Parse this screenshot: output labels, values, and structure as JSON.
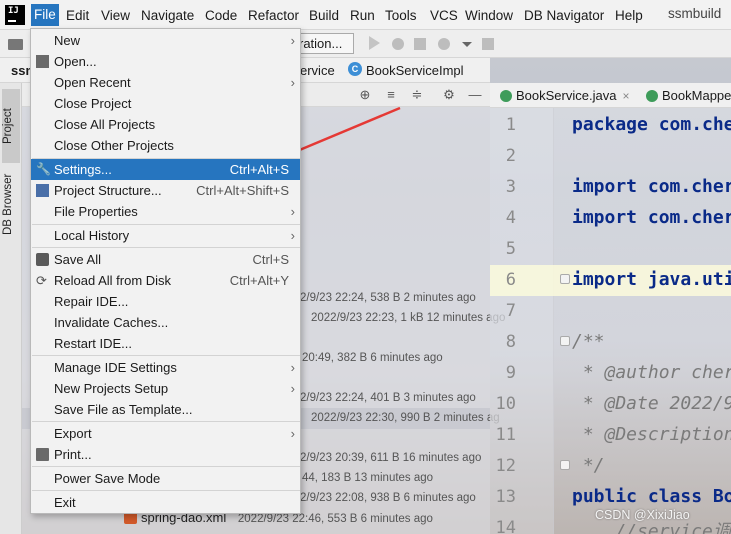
{
  "menubar": {
    "items": [
      "File",
      "Edit",
      "View",
      "Navigate",
      "Code",
      "Refactor",
      "Build",
      "Run",
      "Tools",
      "VCS",
      "Window",
      "DB Navigator",
      "Help"
    ],
    "active": "File",
    "project_name": "ssmbuild"
  },
  "toolbar": {
    "run_config": "ration..."
  },
  "breadcrumb": {
    "project": "ssm",
    "package": "ervice",
    "class": "BookServiceImpl"
  },
  "side_tabs": {
    "project": "Project",
    "db_browser": "DB Browser"
  },
  "project_panel": {
    "file_meta": [
      "2/9/23 22:24, 538 B 2 minutes ago",
      "2022/9/23 22:23, 1 kB 12 minutes ago",
      "20:49, 382 B 6 minutes ago",
      "2/9/23 22:24, 401 B 3 minutes ago",
      "2022/9/23 22:30, 990 B 2 minutes ag",
      "2/9/23 20:39, 611 B 16 minutes ago",
      "44, 183 B 13 minutes ago",
      "2/9/23 22:08, 938 B 6 minutes ago"
    ],
    "last_file": {
      "name": "spring-dao.xml",
      "meta": "2022/9/23 22:46, 553 B 6 minutes ago"
    }
  },
  "editor": {
    "tabs": [
      "BookService.java",
      "BookMappe"
    ],
    "lines": [
      {
        "n": "1",
        "t": "package com.che"
      },
      {
        "n": "2",
        "t": ""
      },
      {
        "n": "3",
        "t": "import com.cher"
      },
      {
        "n": "4",
        "t": "import com.cher"
      },
      {
        "n": "5",
        "t": ""
      },
      {
        "n": "6",
        "t": "import java.uti"
      },
      {
        "n": "7",
        "t": ""
      },
      {
        "n": "8",
        "t": "/**"
      },
      {
        "n": "9",
        "t": " * @author cher"
      },
      {
        "n": "10",
        "t": " * @Date 2022/9"
      },
      {
        "n": "11",
        "t": " * @Description"
      },
      {
        "n": "12",
        "t": " */"
      },
      {
        "n": "13",
        "t": "public class Bo"
      },
      {
        "n": "14",
        "t": "    //service调"
      }
    ]
  },
  "watermark": "CSDN @XixiJiao",
  "file_menu": {
    "items": [
      {
        "label": "New",
        "shortcut": "",
        "submenu": true
      },
      {
        "label": "Open...",
        "shortcut": "",
        "submenu": false
      },
      {
        "label": "Open Recent",
        "shortcut": "",
        "submenu": true
      },
      {
        "label": "Close Project",
        "shortcut": "",
        "submenu": false
      },
      {
        "label": "Close All Projects",
        "shortcut": "",
        "submenu": false
      },
      {
        "label": "Close Other Projects",
        "shortcut": "",
        "submenu": false
      },
      {
        "label": "Settings...",
        "shortcut": "Ctrl+Alt+S",
        "submenu": false
      },
      {
        "label": "Project Structure...",
        "shortcut": "Ctrl+Alt+Shift+S",
        "submenu": false
      },
      {
        "label": "File Properties",
        "shortcut": "",
        "submenu": true
      },
      {
        "label": "Local History",
        "shortcut": "",
        "submenu": true
      },
      {
        "label": "Save All",
        "shortcut": "Ctrl+S",
        "submenu": false
      },
      {
        "label": "Reload All from Disk",
        "shortcut": "Ctrl+Alt+Y",
        "submenu": false
      },
      {
        "label": "Repair IDE...",
        "shortcut": "",
        "submenu": false
      },
      {
        "label": "Invalidate Caches...",
        "shortcut": "",
        "submenu": false
      },
      {
        "label": "Restart IDE...",
        "shortcut": "",
        "submenu": false
      },
      {
        "label": "Manage IDE Settings",
        "shortcut": "",
        "submenu": true
      },
      {
        "label": "New Projects Setup",
        "shortcut": "",
        "submenu": true
      },
      {
        "label": "Save File as Template...",
        "shortcut": "",
        "submenu": false
      },
      {
        "label": "Export",
        "shortcut": "",
        "submenu": true
      },
      {
        "label": "Print...",
        "shortcut": "",
        "submenu": false
      },
      {
        "label": "Power Save Mode",
        "shortcut": "",
        "submenu": false
      },
      {
        "label": "Exit",
        "shortcut": "",
        "submenu": false
      }
    ],
    "selected": "Settings..."
  },
  "colors": {
    "selection": "#2675bf",
    "annotation_arrow": "#e53935",
    "keyword": "#0a2a88"
  }
}
